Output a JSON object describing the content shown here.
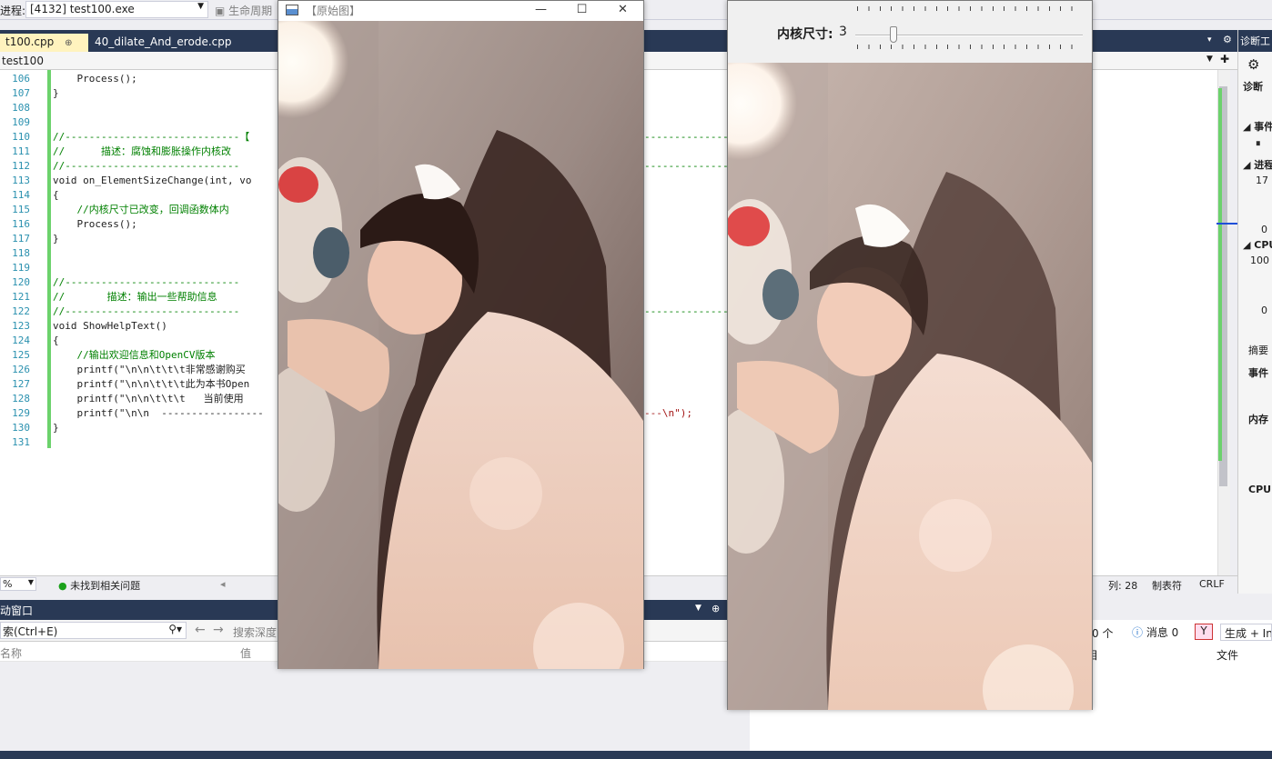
{
  "vs": {
    "process_label": "进程:",
    "process_value": "[4132] test100.exe",
    "lifecycle": "生命周期",
    "tabs": [
      {
        "label": "t100.cpp",
        "pin": "⇩",
        "close": "✕"
      },
      {
        "label": "40_dilate_And_erode.cpp",
        "lock": "🔒"
      }
    ],
    "project": "test100",
    "code_lines": [
      {
        "n": "106",
        "text": "    Process();"
      },
      {
        "n": "107",
        "text": "}"
      },
      {
        "n": "108",
        "text": ""
      },
      {
        "n": "109",
        "text": ""
      },
      {
        "n": "110",
        "text": "//-----------------------------【"
      },
      {
        "n": "111",
        "text": "//      描述：腐蚀和膨胀操作内核改"
      },
      {
        "n": "112",
        "text": "//-----------------------------"
      },
      {
        "n": "113",
        "text": "void on_ElementSizeChange(int, vo"
      },
      {
        "n": "114",
        "text": "{"
      },
      {
        "n": "115",
        "text": "    //内核尺寸已改变，回调函数体内"
      },
      {
        "n": "116",
        "text": "    Process();"
      },
      {
        "n": "117",
        "text": "}"
      },
      {
        "n": "118",
        "text": ""
      },
      {
        "n": "119",
        "text": ""
      },
      {
        "n": "120",
        "text": "//-----------------------------"
      },
      {
        "n": "121",
        "text": "//       描述：输出一些帮助信息"
      },
      {
        "n": "122",
        "text": "//-----------------------------"
      },
      {
        "n": "123",
        "text": "void ShowHelpText()"
      },
      {
        "n": "124",
        "text": "{"
      },
      {
        "n": "125",
        "text": "    //输出欢迎信息和OpenCV版本"
      },
      {
        "n": "126",
        "text": "    printf(\"\\n\\n\\t\\t\\t非常感谢购买"
      },
      {
        "n": "127",
        "text": "    printf(\"\\n\\n\\t\\t\\t此为本书Open"
      },
      {
        "n": "128",
        "text": "    printf(\"\\n\\n\\t\\t\\t   当前使用"
      },
      {
        "n": "129",
        "text": "    printf(\"\\n\\n  -----------------"
      },
      {
        "n": "130",
        "text": "}"
      },
      {
        "n": "131",
        "text": ""
      }
    ],
    "line110_tail": "------------------",
    "line112_tail": "------------------------",
    "line122_tail": "------------------",
    "line129_tail": "---\\n\");",
    "zoom": "%",
    "no_issues": "未找到相关问题",
    "col": "列: 28",
    "tab_type": "制表符",
    "eol": "CRLF",
    "auto_window": "动窗口",
    "search_placeholder": "索(Ctrl+E)",
    "search_depth": "搜索深度",
    "col_name": "名称",
    "col_value": "值",
    "errors_count": "0 个",
    "messages": "消息 0",
    "build": "生成 + In",
    "col_item": "目",
    "col_file": "文件",
    "diag_title": "诊断工",
    "diag_items": [
      "诊断",
      "事件",
      "进程",
      "17",
      "0",
      "CPU",
      "100",
      "0",
      "摘要",
      "事件",
      "内存",
      "CPU"
    ]
  },
  "win_original": {
    "title": "【原始图】",
    "minimize": "—",
    "maximize": "☐",
    "close": "✕"
  },
  "win_result": {
    "kernel_label": "内核尺寸:",
    "kernel_value": "3",
    "kernel_slider_value": 3
  }
}
